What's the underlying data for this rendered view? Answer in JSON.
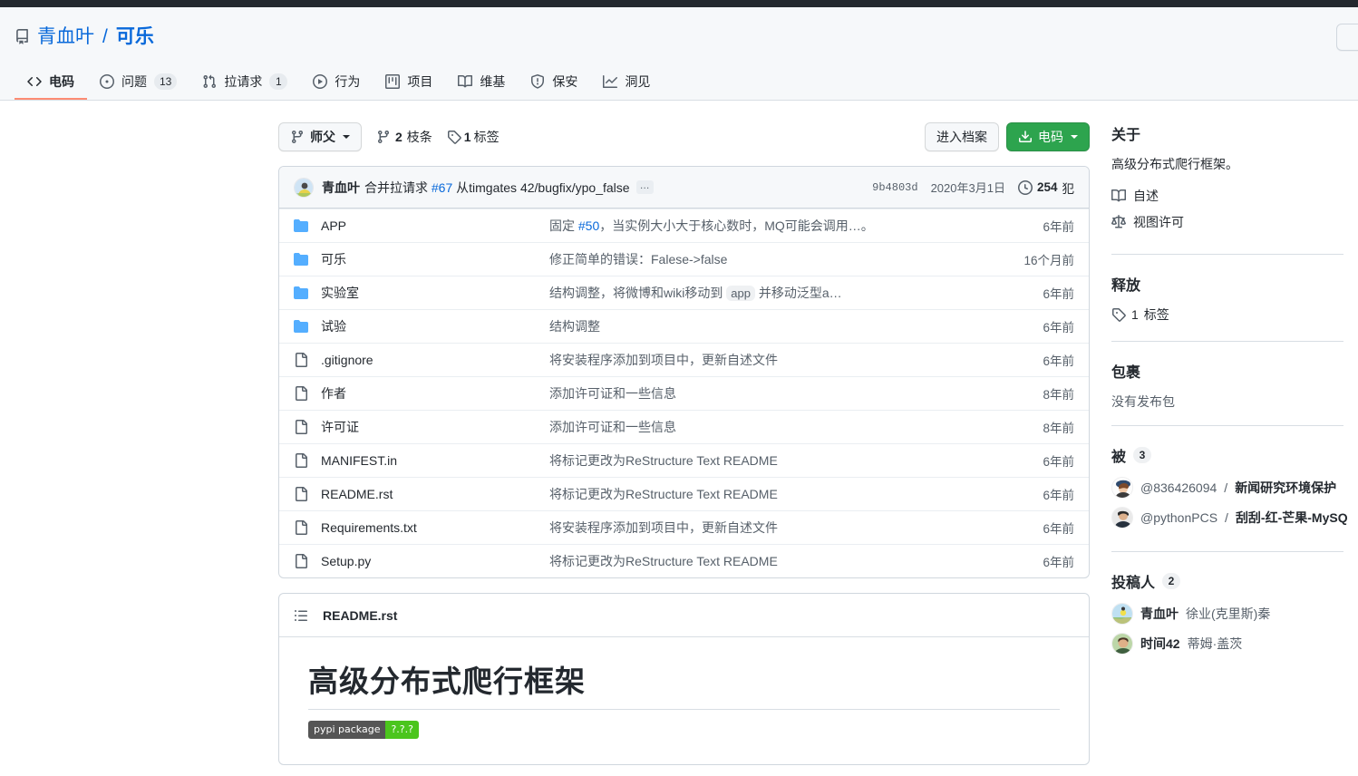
{
  "header": {
    "repo_icon": "repo-icon",
    "owner": "青血叶",
    "separator": "/",
    "name": "可乐"
  },
  "nav": {
    "tabs": [
      {
        "label": "电码",
        "icon": "code-icon",
        "count": null,
        "active": true
      },
      {
        "label": "问题",
        "icon": "issue-opened-icon",
        "count": "13",
        "active": false
      },
      {
        "label": "拉请求",
        "icon": "git-pull-request-icon",
        "count": "1",
        "active": false
      },
      {
        "label": "行为",
        "icon": "play-icon",
        "count": null,
        "active": false
      },
      {
        "label": "项目",
        "icon": "project-icon",
        "count": null,
        "active": false
      },
      {
        "label": "维基",
        "icon": "book-icon",
        "count": null,
        "active": false
      },
      {
        "label": "保安",
        "icon": "shield-icon",
        "count": null,
        "active": false
      },
      {
        "label": "洞见",
        "icon": "graph-icon",
        "count": null,
        "active": false
      }
    ]
  },
  "toolbar": {
    "branch_label": "师父",
    "branches_count": "2",
    "branches_label": "枝条",
    "tags_count": "1",
    "tags_label": "标签",
    "archive_button": "进入档案",
    "code_button": "电码"
  },
  "commit_bar": {
    "author": "青血叶",
    "message_prefix": "合并拉请求",
    "pr_number": "#67",
    "message_suffix": "从timgates 42/bugfix/ypo_false",
    "ellipsis": "…",
    "sha": "9b4803d",
    "date": "2020年3月1日",
    "commits_count": "254",
    "commits_label": "犯"
  },
  "files": [
    {
      "type": "dir",
      "name": "APP",
      "message": "固定 ",
      "issue": "#50",
      "message2": "，当实例大小大于核心数时，MQ可能会调用…。",
      "time": "6年前"
    },
    {
      "type": "dir",
      "name": "可乐",
      "message": "修正简单的错误：Falese->false",
      "time": "16个月前"
    },
    {
      "type": "dir",
      "name": "实验室",
      "message": "结构调整，将微博和wiki移动到 ",
      "code": "app",
      "message2": " 并移动泛型a…",
      "time": "6年前"
    },
    {
      "type": "dir",
      "name": "试验",
      "message": "结构调整",
      "time": "6年前"
    },
    {
      "type": "file",
      "name": ".gitignore",
      "message": "将安装程序添加到项目中，更新自述文件",
      "time": "6年前"
    },
    {
      "type": "file",
      "name": "作者",
      "message": "添加许可证和一些信息",
      "time": "8年前"
    },
    {
      "type": "file",
      "name": "许可证",
      "message": "添加许可证和一些信息",
      "time": "8年前"
    },
    {
      "type": "file",
      "name": "MANIFEST.in",
      "message": "将标记更改为ReStructure Text README",
      "time": "6年前"
    },
    {
      "type": "file",
      "name": "README.rst",
      "message": "将标记更改为ReStructure Text README",
      "time": "6年前"
    },
    {
      "type": "file",
      "name": "Requirements.txt",
      "message": "将安装程序添加到项目中，更新自述文件",
      "time": "6年前"
    },
    {
      "type": "file",
      "name": "Setup.py",
      "message": "将标记更改为ReStructure Text README",
      "time": "6年前"
    }
  ],
  "readme": {
    "filename": "README.rst",
    "heading": "高级分布式爬行框架",
    "badge_left": "pypi package",
    "badge_right": "?.?.?",
    "badge_left_color": "#555555",
    "badge_right_color": "#4bc51d"
  },
  "sidebar": {
    "about": {
      "title": "关于",
      "description": "高级分布式爬行框架。",
      "readme_link": "自述",
      "license_link": "视图许可"
    },
    "releases": {
      "title": "释放",
      "tag_count": "1",
      "tag_label": "标签"
    },
    "packages": {
      "title": "包裹",
      "empty": "没有发布包"
    },
    "forks": {
      "title": "被",
      "count": "3",
      "items": [
        {
          "owner": "@836426094",
          "sep": " / ",
          "name": "新闻研究环境保护"
        },
        {
          "owner": "@pythonPCS",
          "sep": "/",
          "name": "刮刮-红-芒果-MySQ"
        }
      ]
    },
    "contributors": {
      "title": "投稿人",
      "count": "2",
      "items": [
        {
          "name": "青血叶",
          "real": "徐业(克里斯)秦"
        },
        {
          "name": "时间42",
          "real": "蒂姆·盖茨"
        }
      ]
    }
  },
  "colors": {
    "accent_blue": "#0969da",
    "green_button": "#2da44e",
    "active_tab_underline": "#fd8c73",
    "folder_blue": "#54aeff",
    "header_bg": "#f6f8fa"
  }
}
